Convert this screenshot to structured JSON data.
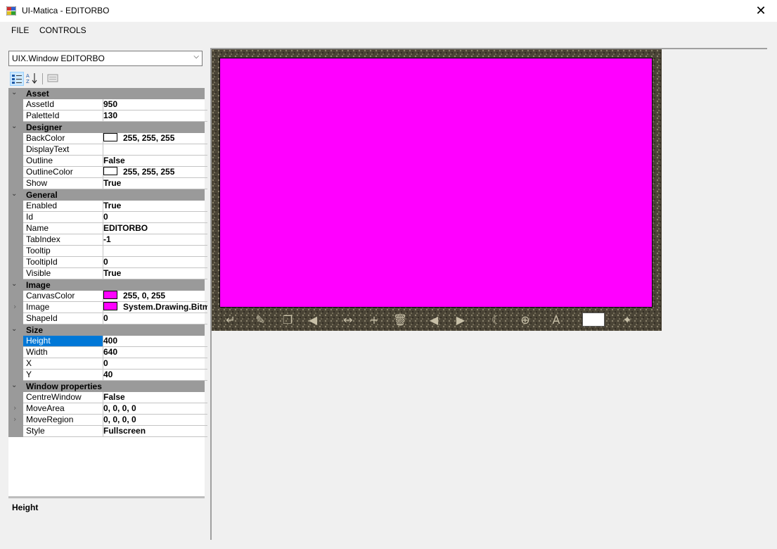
{
  "window": {
    "title": "UI-Matica - EDITORBO",
    "close_glyph": "✕"
  },
  "menu": {
    "items": [
      "FILE",
      "CONTROLS"
    ]
  },
  "combo": {
    "value": "UIX.Window EDITORBO"
  },
  "toolbar": {
    "icons": [
      "categorized-icon",
      "alphabetical-icon",
      "property-pages-icon"
    ]
  },
  "property_grid": {
    "categories": [
      {
        "name": "Asset",
        "properties": [
          {
            "name": "AssetId",
            "value": "950"
          },
          {
            "name": "PaletteId",
            "value": "130"
          }
        ]
      },
      {
        "name": "Designer",
        "properties": [
          {
            "name": "BackColor",
            "value": "255, 255, 255",
            "swatch": "#ffffff"
          },
          {
            "name": "DisplayText",
            "value": ""
          },
          {
            "name": "Outline",
            "value": "False"
          },
          {
            "name": "OutlineColor",
            "value": "255, 255, 255",
            "swatch": "#ffffff"
          },
          {
            "name": "Show",
            "value": "True"
          }
        ]
      },
      {
        "name": "General",
        "properties": [
          {
            "name": "Enabled",
            "value": "True"
          },
          {
            "name": "Id",
            "value": "0"
          },
          {
            "name": "Name",
            "value": "EDITORBO"
          },
          {
            "name": "TabIndex",
            "value": "-1"
          },
          {
            "name": "Tooltip",
            "value": ""
          },
          {
            "name": "TooltipId",
            "value": "0"
          },
          {
            "name": "Visible",
            "value": "True"
          }
        ]
      },
      {
        "name": "Image",
        "properties": [
          {
            "name": "CanvasColor",
            "value": "255, 0, 255",
            "swatch": "#ff00ff"
          },
          {
            "name": "Image",
            "value": "System.Drawing.Bitm",
            "swatch": "#ff00ff",
            "expandable": true
          },
          {
            "name": "ShapeId",
            "value": "0"
          }
        ]
      },
      {
        "name": "Size",
        "properties": [
          {
            "name": "Height",
            "value": "400",
            "selected": true
          },
          {
            "name": "Width",
            "value": "640"
          },
          {
            "name": "X",
            "value": "0"
          },
          {
            "name": "Y",
            "value": "40"
          }
        ]
      },
      {
        "name": "Window properties",
        "properties": [
          {
            "name": "CentreWindow",
            "value": "False"
          },
          {
            "name": "MoveArea",
            "value": "0, 0, 0, 0",
            "expandable": true
          },
          {
            "name": "MoveRegion",
            "value": "0, 0, 0, 0",
            "expandable": true
          },
          {
            "name": "Style",
            "value": "Fullscreen"
          }
        ]
      }
    ]
  },
  "description": {
    "title": "Height"
  },
  "preview": {
    "canvas_color": "#ff00ff",
    "buttons": [
      {
        "icon": "enter-icon",
        "glyph": "↵"
      },
      {
        "icon": "edit-icon",
        "glyph": "✎"
      },
      {
        "icon": "copy-icon",
        "glyph": "❐"
      },
      {
        "icon": "sound-icon",
        "glyph": "◀"
      },
      {
        "icon": "resize-icon",
        "glyph": "↔"
      },
      {
        "icon": "add-icon",
        "glyph": "+"
      },
      {
        "icon": "trash-icon",
        "glyph": "🗑"
      },
      {
        "icon": "arrow-left-icon",
        "glyph": "◀"
      },
      {
        "icon": "arrow-right-icon",
        "glyph": "▶"
      },
      {
        "icon": "moon-icon",
        "glyph": "☾"
      },
      {
        "icon": "globe-icon",
        "glyph": "⊕"
      },
      {
        "icon": "font-icon",
        "glyph": "A"
      },
      {
        "icon": "run-icon",
        "glyph": "✦"
      }
    ]
  }
}
